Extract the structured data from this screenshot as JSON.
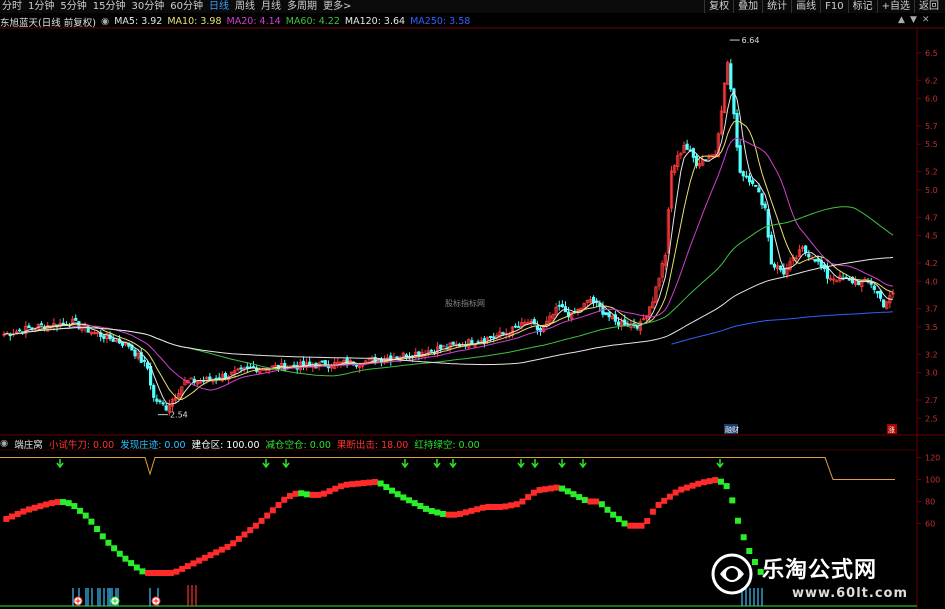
{
  "toolbar": {
    "periods": [
      "分时",
      "1分钟",
      "5分钟",
      "15分钟",
      "30分钟",
      "60分钟",
      "日线",
      "周线",
      "月线",
      "多周期",
      "更多>"
    ],
    "active_index": 6,
    "right": [
      "复权",
      "叠加",
      "统计",
      "画线",
      "F10",
      "标记",
      "+自选",
      "返回"
    ]
  },
  "info_bar": {
    "stock": "东旭蓝天(日线 前复权)",
    "items": [
      {
        "label": "MA5: 3.92",
        "color": "#e6e6e6"
      },
      {
        "label": "MA10: 3.98",
        "color": "#e8e070"
      },
      {
        "label": "MA20: 4.14",
        "color": "#d040d0"
      },
      {
        "label": "MA60: 4.22",
        "color": "#40c040"
      },
      {
        "label": "MA120: 3.64",
        "color": "#e6e6e6"
      },
      {
        "label": "MA250: 3.58",
        "color": "#3060ff"
      }
    ]
  },
  "indicator_bar": {
    "name": "端庄窝",
    "items": [
      {
        "label": "小试牛刀: 0.00",
        "color": "#ff3030"
      },
      {
        "label": "发现庄迹: 0.00",
        "color": "#30c0ff"
      },
      {
        "label": "建仓区: 100.00",
        "color": "#ffffff"
      },
      {
        "label": "减仓空仓: 0.00",
        "color": "#30e030"
      },
      {
        "label": "果断出击: 18.00",
        "color": "#ff3030"
      },
      {
        "label": "红持绿空: 0.00",
        "color": "#30e030"
      }
    ]
  },
  "controls": {
    "up": "▲",
    "down": "▼",
    "close": "✕"
  },
  "main_axis": [
    "6.5",
    "6.2",
    "6.0",
    "5.7",
    "5.5",
    "5.2",
    "5.0",
    "4.7",
    "4.5",
    "4.2",
    "4.0",
    "3.7",
    "3.5",
    "3.2",
    "3.0",
    "2.7",
    "2.5"
  ],
  "ind_axis": [
    "120",
    "100",
    "80",
    "60"
  ],
  "annotations": {
    "high": "6.64",
    "low": "2.54",
    "center_watermark": "股标指标网",
    "event_mark": "融财",
    "event_mark2": "涨"
  },
  "watermark": {
    "title": "乐淘公式网",
    "url": "www.60lt.com"
  }
}
